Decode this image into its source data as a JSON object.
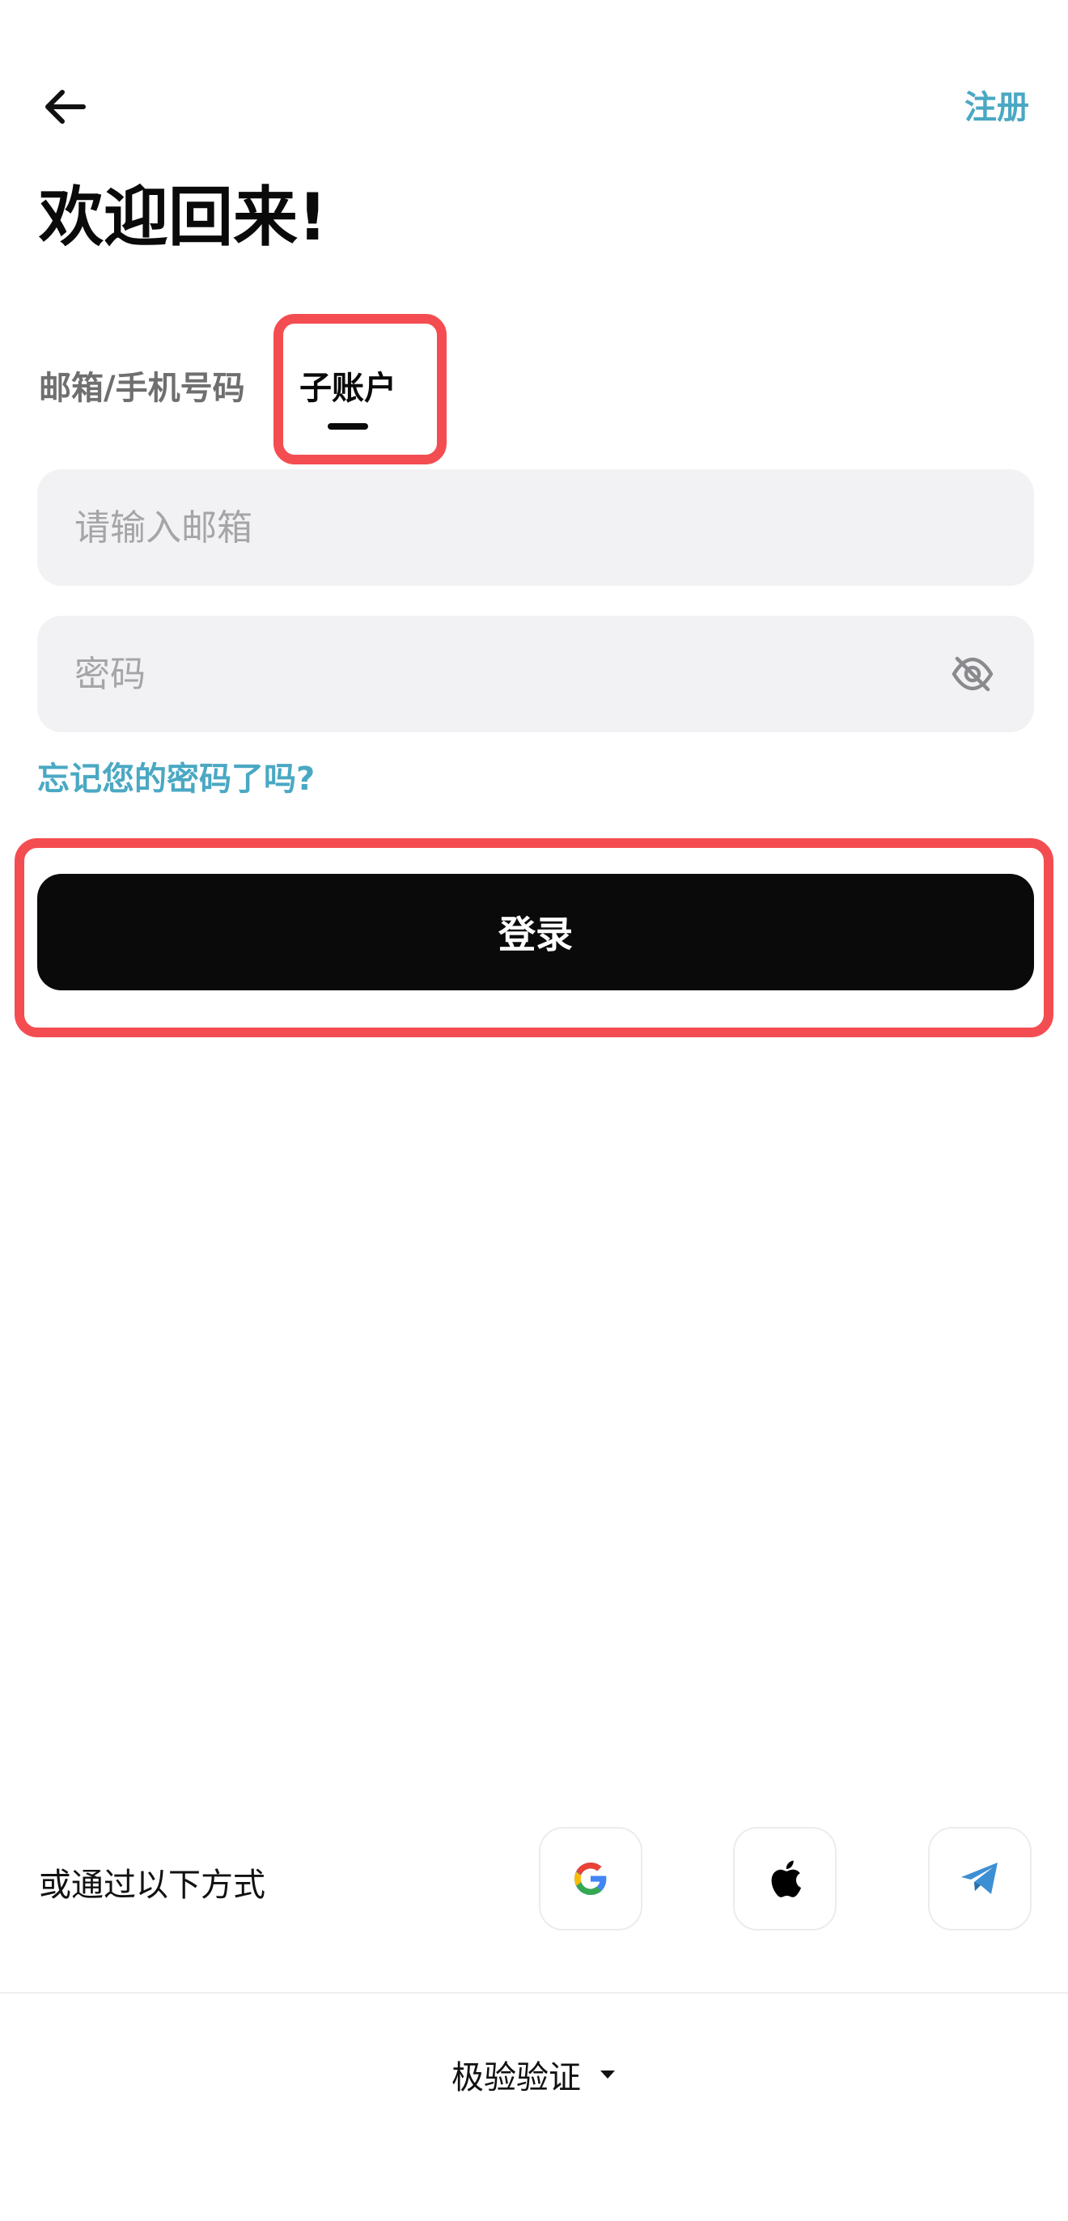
{
  "header": {
    "back_icon": "arrow-left-icon",
    "register_label": "注册"
  },
  "title": "欢迎回来!",
  "tabs": [
    {
      "label": "邮箱/手机号码",
      "active": false
    },
    {
      "label": "子账户",
      "active": true
    }
  ],
  "form": {
    "email_placeholder": "请输入邮箱",
    "email_value": "",
    "password_placeholder": "密码",
    "password_value": "",
    "password_toggle_icon": "eye-off-icon",
    "forgot_label": "忘记您的密码了吗?",
    "login_label": "登录"
  },
  "social": {
    "label": "或通过以下方式",
    "providers": [
      "google-icon",
      "apple-icon",
      "telegram-icon"
    ]
  },
  "captcha": {
    "label": "极验验证",
    "icon": "caret-down-icon"
  },
  "colors": {
    "accent": "#4aa8c3",
    "highlight": "#f44d51",
    "button": "#0a0a0a",
    "input_bg": "#f2f2f4"
  }
}
